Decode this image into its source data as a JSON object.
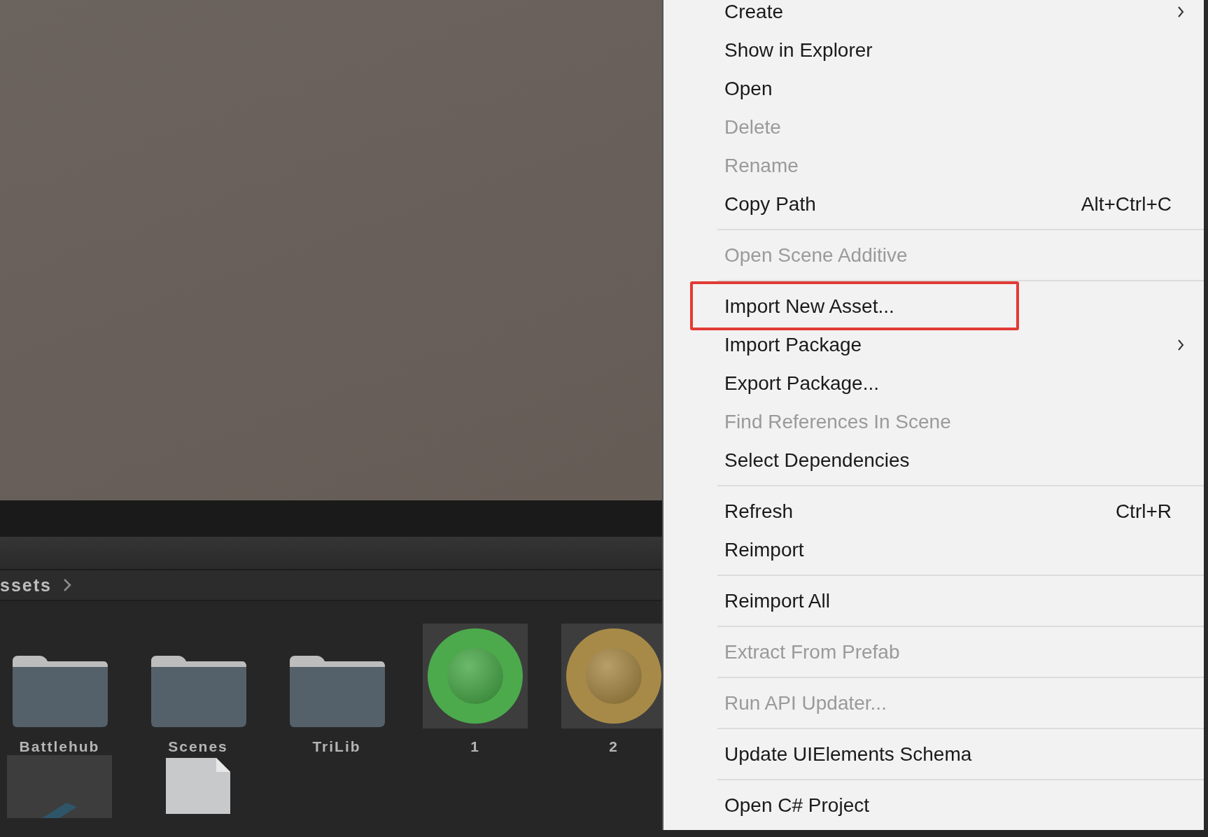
{
  "breadcrumb": {
    "text": "ssets"
  },
  "assets": [
    {
      "kind": "folder",
      "name": "Battlehub"
    },
    {
      "kind": "folder",
      "name": "Scenes"
    },
    {
      "kind": "folder",
      "name": "TriLib"
    },
    {
      "kind": "material",
      "name": "1",
      "color": "#4caa4c"
    },
    {
      "kind": "material",
      "name": "2",
      "color": "#a88a48"
    },
    {
      "kind": "prefab"
    },
    {
      "kind": "file"
    }
  ],
  "context_menu": {
    "groups": [
      [
        {
          "label": "Create",
          "disabled": false,
          "submenu": true,
          "outlined": false
        },
        {
          "label": "Show in Explorer",
          "disabled": false,
          "submenu": false,
          "outlined": false
        },
        {
          "label": "Open",
          "disabled": false,
          "submenu": false,
          "outlined": false
        },
        {
          "label": "Delete",
          "disabled": true,
          "submenu": false,
          "outlined": false
        },
        {
          "label": "Rename",
          "disabled": true,
          "submenu": false,
          "outlined": false
        },
        {
          "label": "Copy Path",
          "disabled": false,
          "submenu": false,
          "outlined": false,
          "shortcut": "Alt+Ctrl+C"
        }
      ],
      [
        {
          "label": "Open Scene Additive",
          "disabled": true,
          "submenu": false,
          "outlined": false
        }
      ],
      [
        {
          "label": "Import New Asset...",
          "disabled": false,
          "submenu": false,
          "outlined": true
        },
        {
          "label": "Import Package",
          "disabled": false,
          "submenu": true,
          "outlined": false
        },
        {
          "label": "Export Package...",
          "disabled": false,
          "submenu": false,
          "outlined": false
        },
        {
          "label": "Find References In Scene",
          "disabled": true,
          "submenu": false,
          "outlined": false
        },
        {
          "label": "Select Dependencies",
          "disabled": false,
          "submenu": false,
          "outlined": false
        }
      ],
      [
        {
          "label": "Refresh",
          "disabled": false,
          "submenu": false,
          "outlined": false,
          "shortcut": "Ctrl+R"
        },
        {
          "label": "Reimport",
          "disabled": false,
          "submenu": false,
          "outlined": false
        }
      ],
      [
        {
          "label": "Reimport All",
          "disabled": false,
          "submenu": false,
          "outlined": false
        }
      ],
      [
        {
          "label": "Extract From Prefab",
          "disabled": true,
          "submenu": false,
          "outlined": false
        }
      ],
      [
        {
          "label": "Run API Updater...",
          "disabled": true,
          "submenu": false,
          "outlined": false
        }
      ],
      [
        {
          "label": "Update UIElements Schema",
          "disabled": false,
          "submenu": false,
          "outlined": false
        }
      ],
      [
        {
          "label": "Open C# Project",
          "disabled": false,
          "submenu": false,
          "outlined": false
        }
      ]
    ]
  }
}
